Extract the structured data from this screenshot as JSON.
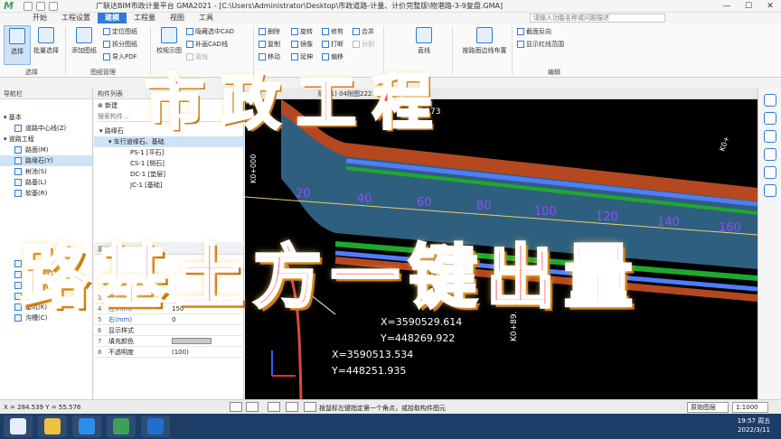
{
  "window": {
    "title": "广联达BIM市政计量平台 GMA2021 - [C:\\Users\\Administrator\\Desktop\\市政道路-计量、计价完整版\\物港路-3-9复盘.GMA]",
    "minimize": "—",
    "maximize": "☐",
    "close": "✕"
  },
  "menu": {
    "tabs": [
      "开始",
      "工程设置",
      "建模",
      "工程量",
      "视图",
      "工具"
    ],
    "active_index": 2,
    "search_placeholder": "请输入功能名称或问题描述"
  },
  "ribbon": {
    "select": "选择",
    "batch_select": "批量选择",
    "select_group": "选择",
    "add_drawing": "添加图纸",
    "locate_drawing": "定位图纸",
    "split_drawing": "拆分图纸",
    "import_pdf": "导入PDF",
    "drawing_group": "图纸管理",
    "correct_drawing": "校规示图",
    "hide_cad": "隐藏选中CAD",
    "fill_cad_line": "补画CAD线",
    "straight_dis": "直线",
    "delete": "删除",
    "copy": "复制",
    "move": "移动",
    "rotate": "旋转",
    "mirror": "镜像",
    "extend": "延伸",
    "trim": "修剪",
    "break": "打断",
    "offset": "偏移",
    "merge": "合并",
    "split": "分割",
    "line": "直线",
    "layout_by_edge": "按路面边线布置",
    "section_reverse": "截面反向",
    "show_red_line": "显示红线范围",
    "edit_group": "编辑"
  },
  "nav": {
    "header": "导航栏",
    "sections": {
      "basic": "基本",
      "road": "道路工程"
    },
    "basic_items": [
      "道路中心线(Z)"
    ],
    "road_items": [
      "路面(M)",
      "路缘石(Y)",
      "树池(S)",
      "路基(L)",
      "软基(R)"
    ],
    "selected_road_item": 1,
    "pipe_items": [
      "雨水管(G)",
      "雨水口(S)",
      "污水井(J)",
      "污水管(P)",
      "基坑(K)",
      "沟槽(C)"
    ]
  },
  "component_list": {
    "header": "构件列表",
    "new_label": "新建",
    "search_placeholder": "搜索构件...",
    "root": "路缘石",
    "selected": "车行道缘石、基础",
    "children": [
      "PS-1 [平石]",
      "CS-1 [侧石]",
      "DC-1 [垫层]",
      "JC-1 [基础]"
    ]
  },
  "properties": {
    "header": "属性",
    "rows": [
      {
        "num": "3",
        "key": "截面尺寸信...",
        "value": ""
      },
      {
        "num": "4",
        "key": "左(mm)",
        "value": "150"
      },
      {
        "num": "5",
        "key": "右(mm)",
        "value": "0"
      },
      {
        "num": "6",
        "key": "显示样式",
        "value": ""
      },
      {
        "num": "7",
        "key": "填充颜色",
        "value": ""
      },
      {
        "num": "8",
        "key": "不透明度",
        "value": "(100)"
      }
    ]
  },
  "canvas": {
    "tab_label": "系) (1)         04附图2222",
    "station_labels": [
      "20",
      "40",
      "60",
      "80",
      "100",
      "120",
      "140",
      "160"
    ],
    "station_start": "K0+000",
    "station_right": "K0+",
    "station_lower": "K0+89.",
    "top_text": "57.173",
    "coord1_x": "X=3590529.614",
    "coord1_y": "Y=448269.922",
    "coord2_x": "X=3590513.534",
    "coord2_y": "Y=448251.935",
    "colors": {
      "road_surface": "#2f5f7e",
      "curb_band": "#b5481e",
      "green_line": "#1fa82e",
      "blue_line": "#4f7dfd",
      "station_text": "#8c4dff",
      "coord_text": "#ffffff",
      "alignment": "#e8cf6a"
    }
  },
  "overlay": {
    "title": "市政工程",
    "subtitle": "路基土方一键出量",
    "color": "#ff4040"
  },
  "status": {
    "coord": "X = 284.539 Y = 55.576",
    "hint": "按鼠标左键指定第一个角点，或拾取构件图元",
    "layer": "原始图层",
    "scale": "1:1000"
  },
  "clock": {
    "time": "19:57 周五",
    "date": "2022/3/11"
  }
}
